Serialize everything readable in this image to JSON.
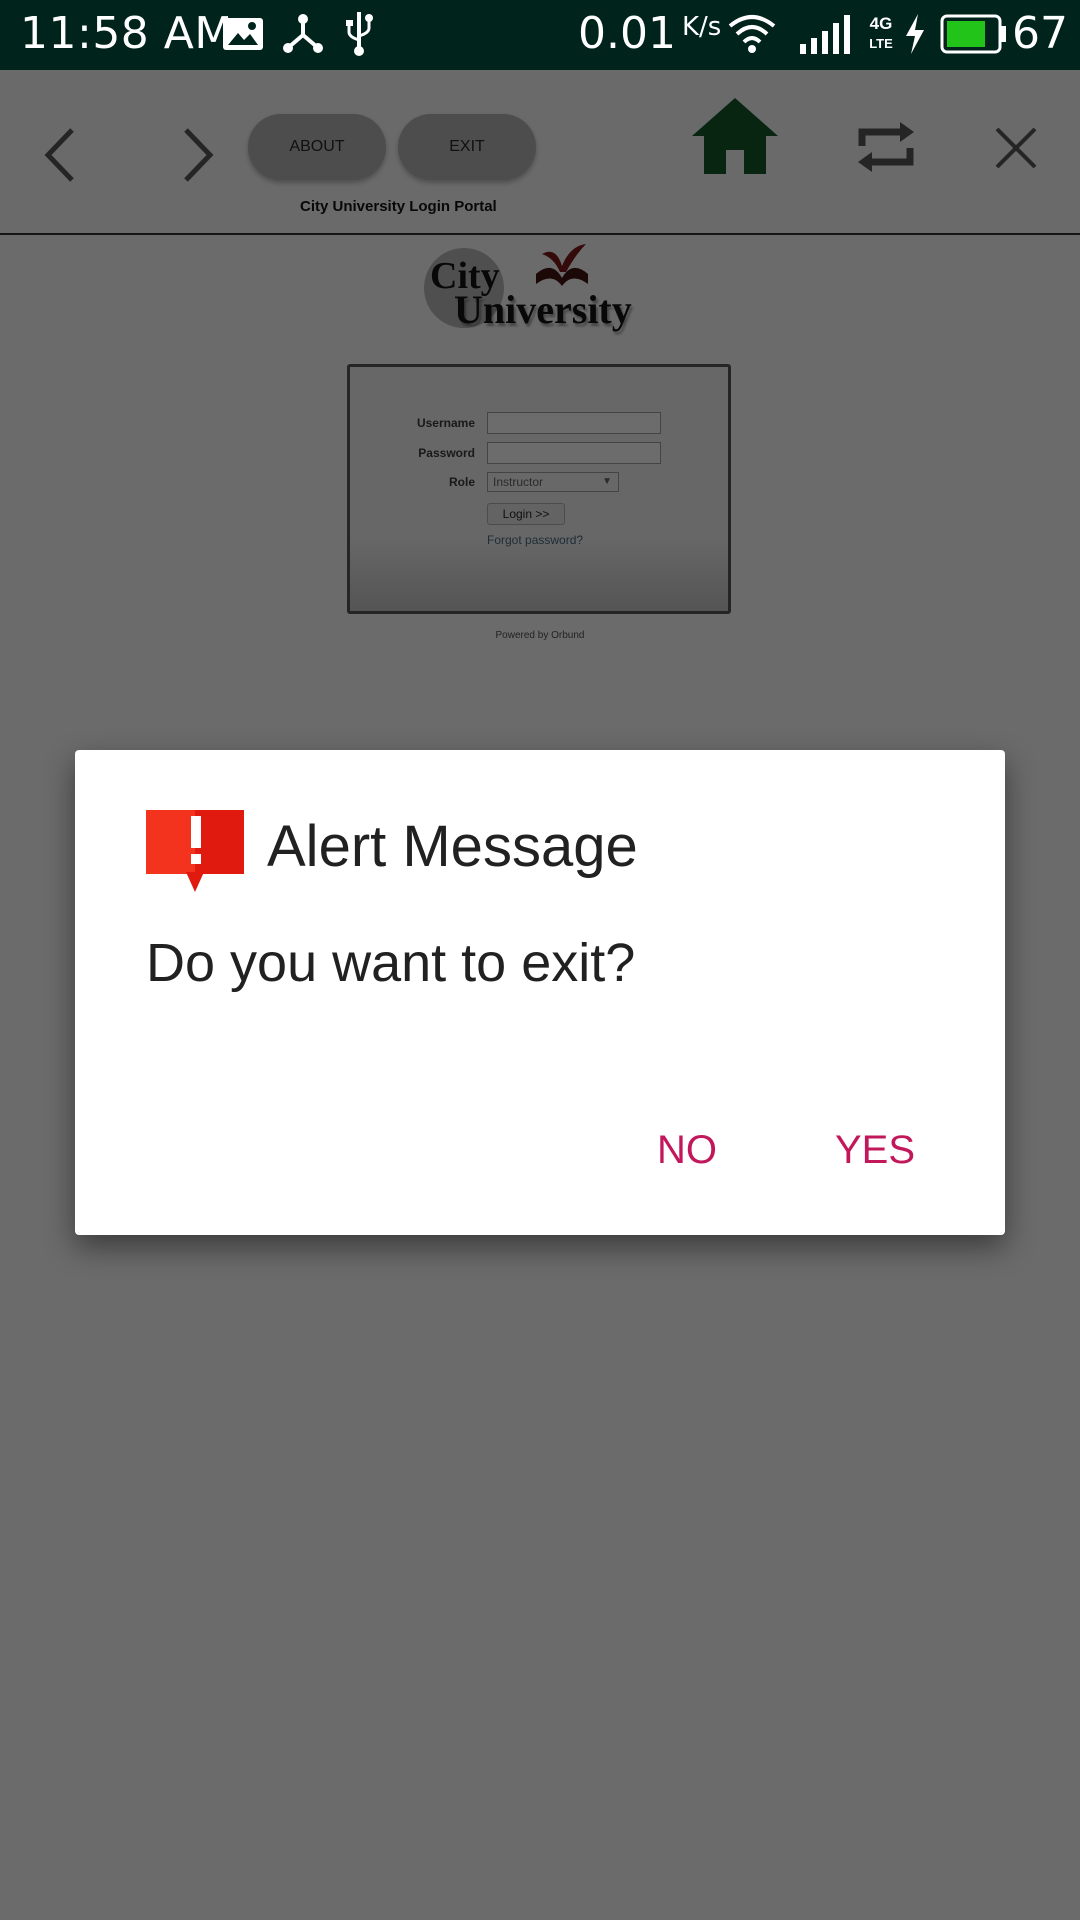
{
  "status_bar": {
    "time": "11:58 AM",
    "net_speed": "0.01",
    "net_speed_unit": "K/s",
    "network_type": "4G LTE",
    "battery_percent": "67",
    "icons": [
      "image-notification-icon",
      "share-icon",
      "usb-icon",
      "wifi-icon",
      "signal-icon",
      "charging-icon",
      "battery-icon"
    ]
  },
  "toolbar": {
    "back_icon": "chevron-left-icon",
    "forward_icon": "chevron-right-icon",
    "about_label": "ABOUT",
    "exit_label": "EXIT",
    "home_icon": "home-icon",
    "refresh_icon": "refresh-icon",
    "close_icon": "close-icon",
    "portal_title": "City University Login Portal",
    "home_color": "#1b7f3a"
  },
  "login": {
    "logo_line1": "City",
    "logo_line2": "University",
    "username_label": "Username",
    "password_label": "Password",
    "role_label": "Role",
    "role_value": "Instructor",
    "login_button": "Login >>",
    "forgot_link": "Forgot password?",
    "powered_by": "Powered by Orbund"
  },
  "dialog": {
    "title": "Alert Message",
    "message": "Do you want to exit?",
    "no_label": "NO",
    "yes_label": "YES",
    "icon": "alert-icon",
    "accent_color": "#c2185b"
  }
}
